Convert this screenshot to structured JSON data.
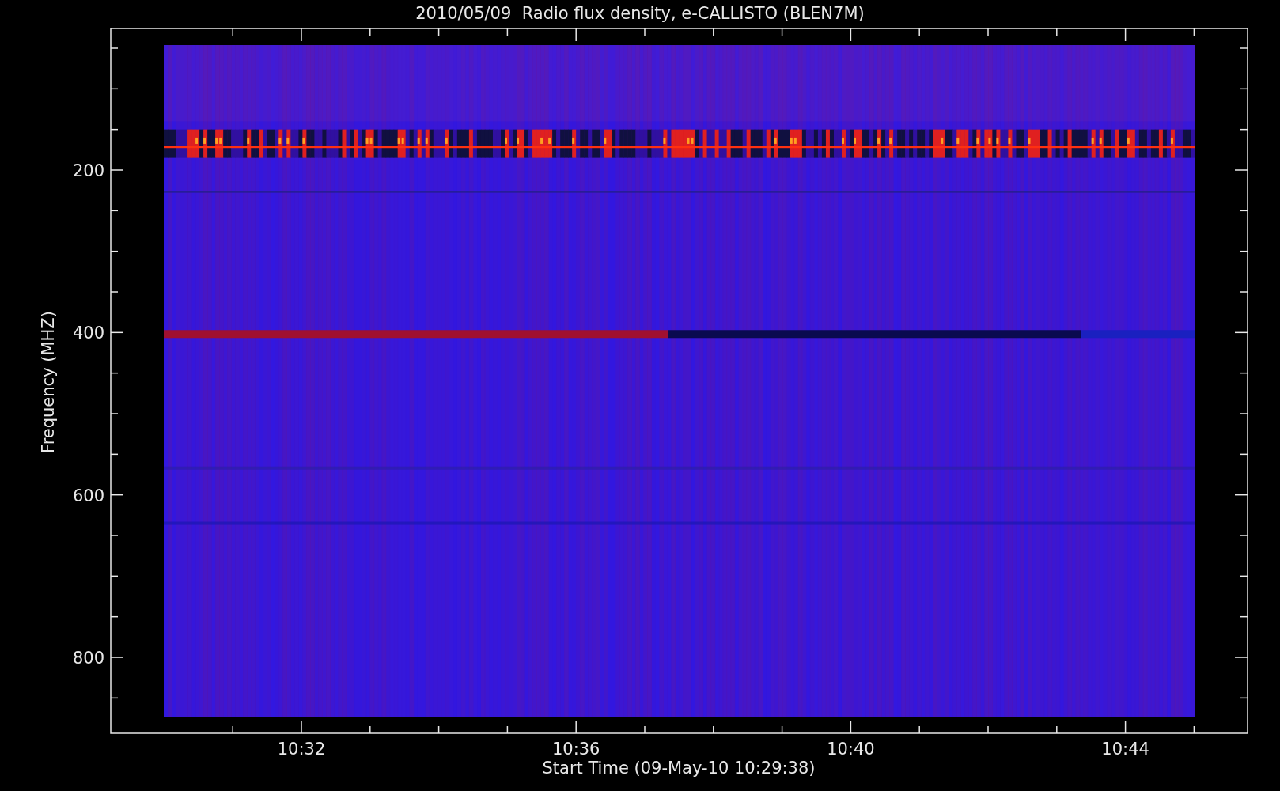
{
  "plot": {
    "title": "2010/05/09  Radio flux density, e-CALLISTO (BLEN7M)",
    "y_axis": {
      "label": "Frequency (MHZ)",
      "ticks": [
        "200",
        "400",
        "600",
        "800"
      ]
    },
    "x_axis": {
      "label": "Start Time (09-May-10 10:29:38)",
      "ticks": [
        "10:32",
        "10:36",
        "10:40",
        "10:44"
      ]
    }
  }
}
